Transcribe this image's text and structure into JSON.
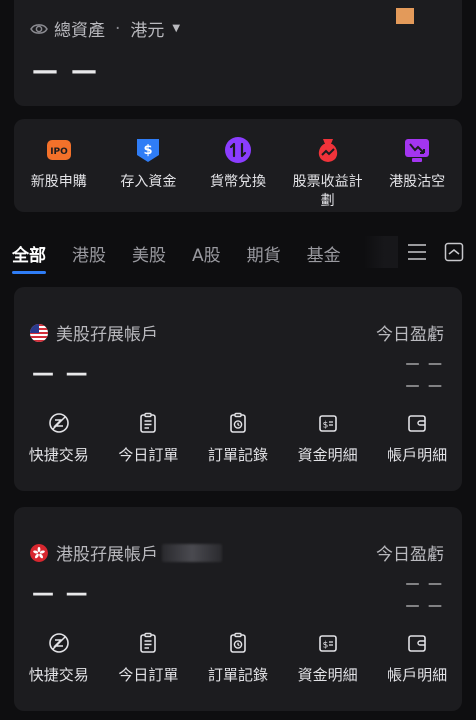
{
  "asset": {
    "label": "總資產",
    "separator": "·",
    "currency": "港元",
    "value": "— —"
  },
  "quick_actions": [
    {
      "label": "新股申購",
      "icon": "ipo-icon",
      "icon_text": "IPO",
      "color": "#f3712a"
    },
    {
      "label": "存入資金",
      "icon": "deposit-icon",
      "icon_text": "$",
      "color": "#2f7df6"
    },
    {
      "label": "貨幣兌換",
      "icon": "currency-exchange-icon",
      "icon_text": "⇅",
      "color": "#8b3dff"
    },
    {
      "label": "股票收益計劃",
      "icon": "stock-yield-icon",
      "icon_text": "",
      "color": "#f0333a"
    },
    {
      "label": "港股沽空",
      "icon": "short-sell-icon",
      "icon_text": "",
      "color": "#a335f0"
    }
  ],
  "tabs": [
    {
      "label": "全部",
      "active": true
    },
    {
      "label": "港股",
      "active": false
    },
    {
      "label": "美股",
      "active": false
    },
    {
      "label": "A股",
      "active": false
    },
    {
      "label": "期貨",
      "active": false
    },
    {
      "label": "基金",
      "active": false
    }
  ],
  "accounts": [
    {
      "name": "美股孖展帳戶",
      "flag": "us-flag-icon",
      "pl_label": "今日盈虧",
      "value": "— —",
      "pl_values": [
        "— —",
        "— —"
      ],
      "actions": [
        "快捷交易",
        "今日訂單",
        "訂單記錄",
        "資金明細",
        "帳戶明細"
      ]
    },
    {
      "name": "港股孖展帳戶",
      "flag": "hk-flag-icon",
      "pl_label": "今日盈虧",
      "value": "— —",
      "pl_values": [
        "— —",
        "— —"
      ],
      "actions": [
        "快捷交易",
        "今日訂單",
        "訂單記錄",
        "資金明細",
        "帳戶明細"
      ]
    }
  ],
  "colors": {
    "background": "#0e0e10",
    "card": "#1c1c1f",
    "accent": "#2f7df6"
  }
}
